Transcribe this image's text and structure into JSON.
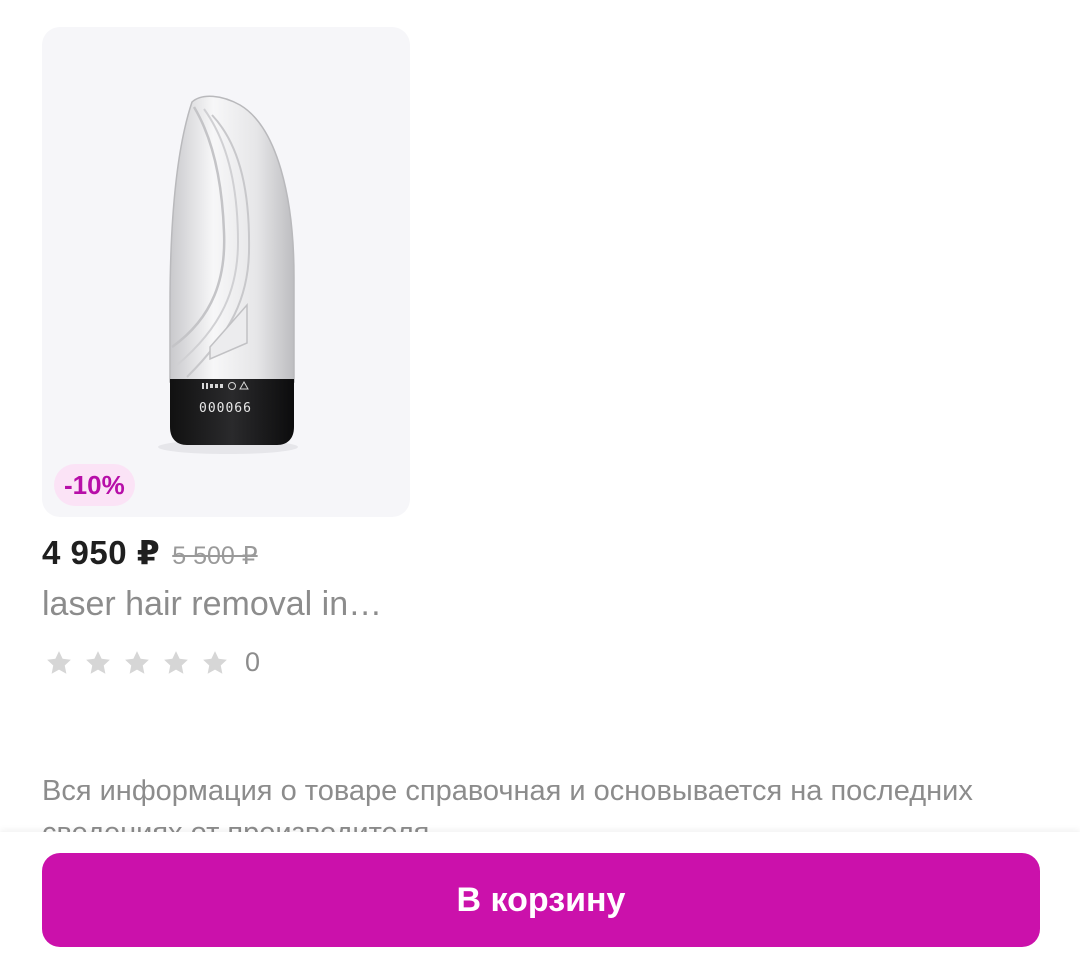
{
  "product": {
    "discount_badge": "-10%",
    "price_current": "4 950 ₽",
    "price_old": "5 500 ₽",
    "title": "laser hair removal in…",
    "rating": {
      "stars_filled": 0,
      "stars_total": 5,
      "review_count": "0"
    },
    "device_display": {
      "counter": "000066",
      "icons": "▮▮▮▮ ⓥ ≋"
    }
  },
  "info": {
    "text": "Вся информация о товаре справочная и основывается на последних сведениях от производителя"
  },
  "actions": {
    "add_to_cart_label": "В корзину"
  },
  "colors": {
    "brand_accent": "#cb11ab",
    "badge_background": "#fbe3f6",
    "badge_text": "#b70ea8",
    "star_empty": "#d6d6d6",
    "muted_text": "#8c8c8c"
  }
}
